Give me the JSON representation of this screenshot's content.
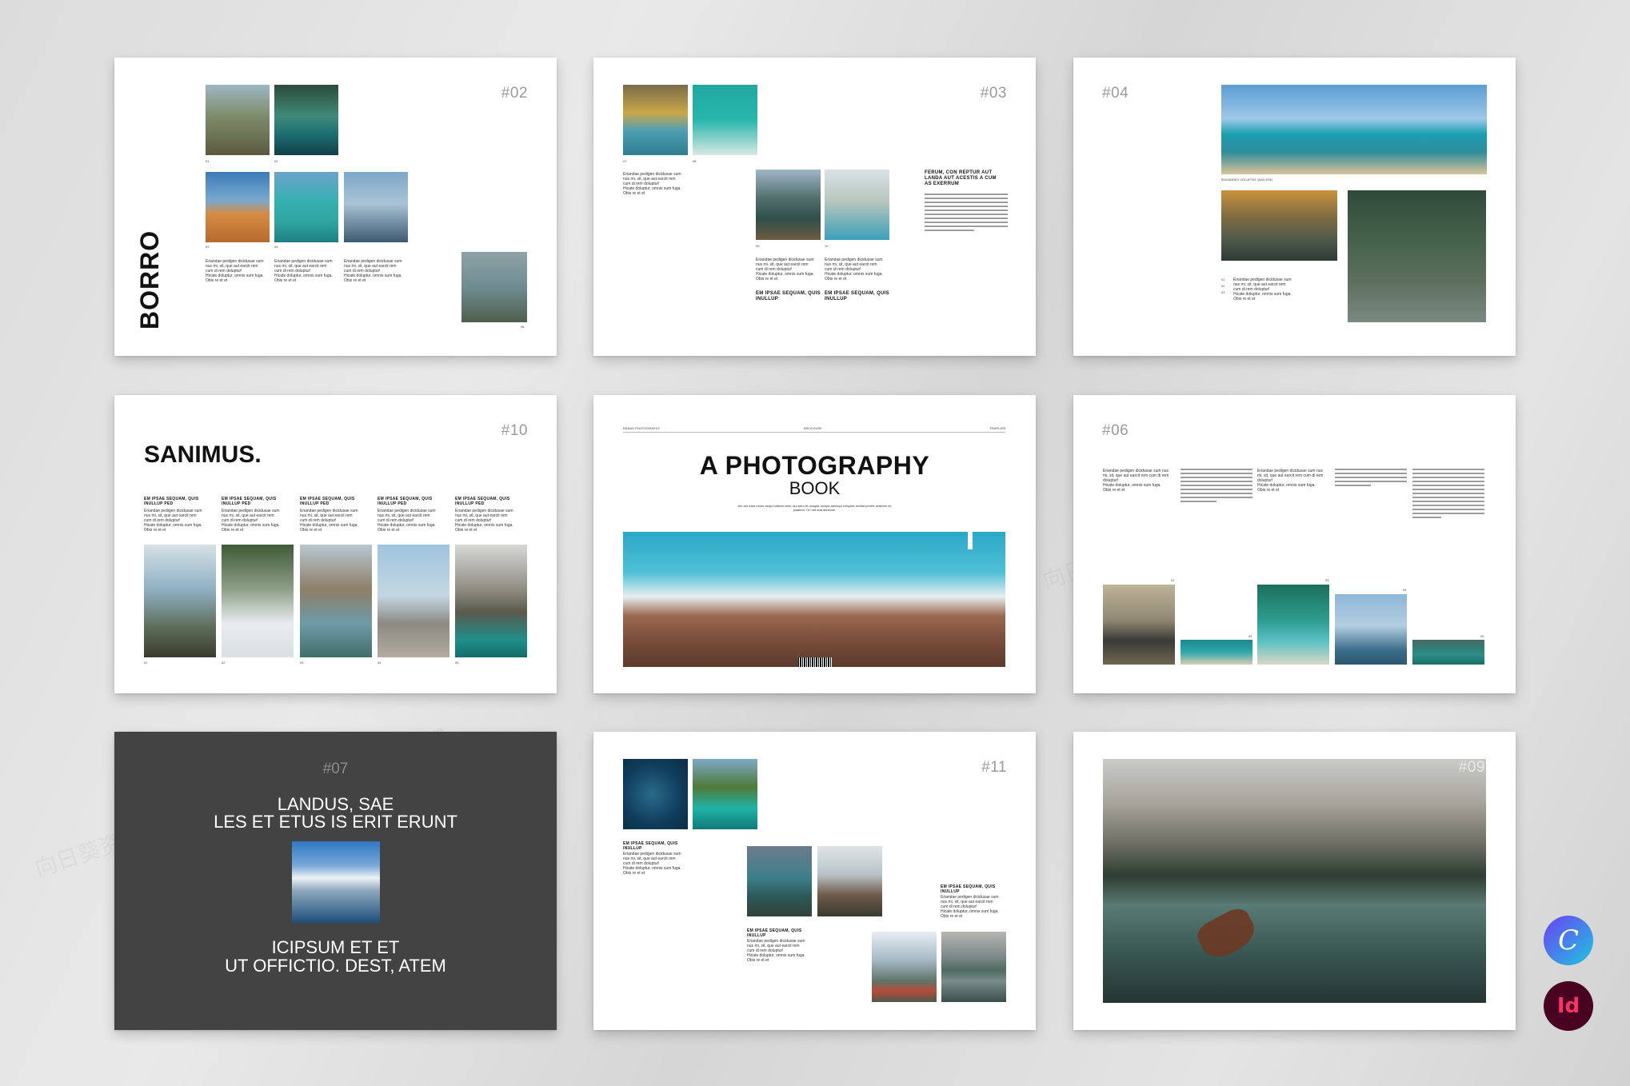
{
  "pages": {
    "p02": {
      "number": "#02",
      "title": "BORRO",
      "caption_01": "01",
      "caption_02": "02",
      "caption_03": "03",
      "caption_04": "04",
      "caption_05": "05",
      "caption_06": "06",
      "body": "Eriandae pedigen dicidusae sum\nnus mi, sit, que aut earcit rem\ncum di rem doluptur!\nHicate doluptur, omnis sum fuga.\nObis re et et"
    },
    "p03": {
      "number": "#03",
      "caption_07": "07",
      "caption_08": "08",
      "caption_09": "09",
      "caption_10": "10",
      "body": "Eriandae pedigen dicidusae sum\nnus mi, sit, que aut earcit rem\ncum di rem doluptur!\nHicate doluptur, omnis sum fuga.\nObis re et et",
      "heading": "EM IPSAE SEQUAM, QUIS\nINULLUP",
      "quote": "FERUM, CON REPTUR AUT\nLANDA AUT ACESTIS A CUM\nAS EXERRUM"
    },
    "p04": {
      "number": "#04",
      "caption": "BUDANDEX VOLUPTAT QIAS ESN",
      "item_1": "01",
      "item_2": "02",
      "item_3": "03",
      "body": "Eriandae pedigen dicidusae sum\nnus mi, sit, que aut earcit rem\ncum di rem doluptur!\nHicate doluptur, omnis sum fuga.\nObis re et et"
    },
    "p10": {
      "number": "#10",
      "title": "SANIMUS.",
      "column_heading": "EM IPSAE SEQUAM, QUIS\nINULLUP PED",
      "body": "Eriandae pedigen dicidusae sum\nnus mi, sit, que aut earcit rem\ncum di rem doluptur!\nHicate doluptur, omnis sum fuga.\nObis re et et",
      "captions": [
        "01",
        "02",
        "03",
        "04",
        "05"
      ]
    },
    "cover": {
      "top_left": "BRAND PHOTOGRAPHY",
      "top_center": "BROCHURE",
      "top_right": "TEMPLATE",
      "title": "A PHOTOGRAPHY",
      "subtitle": "BOOK",
      "intro": "Am am eara molor aequi blaboni iatet, aut pero te dolupta dolupti atemqui volupiae eiciliat prerfer ataleste ne\nplaatem. Ori unt ada atessum."
    },
    "p06": {
      "number": "#06",
      "body": "Eriandae pedigen dicidusae sum nus mi, sit, que aut earcit rem cum di rem doluptur!\nHicate doluptur, omnis sum fuga.\nObis re et et",
      "captions": [
        "01",
        "02",
        "03",
        "04",
        "05"
      ]
    },
    "p07": {
      "number": "#07",
      "line_1": "LANDUS, SAE",
      "line_2": "LES ET ETUS IS ERIT ERUNT",
      "line_3": "ICIPSUM ET ET",
      "line_4": "UT OFFICTIO. DEST, ATEM"
    },
    "p11": {
      "number": "#11",
      "heading": "EM IPSAE SEQUAM, QUIS\nINULLUP",
      "body": "Eriandae pedigen dicidusae sum\nnus mi, sit, que aut earcit rem\ncum di rem doluptur!\nHicate doluptur, omnis sum fuga.\nObis re et et"
    },
    "p09": {
      "number": "#09"
    }
  },
  "badges": {
    "canva": {
      "glyph": "C",
      "gradient": [
        "#6b3ff2",
        "#1fc6e0"
      ]
    },
    "indesign": {
      "glyph": "Id",
      "color": "#49021f",
      "text_color": "#ff3366"
    }
  },
  "watermark": {
    "text_1": "向日葵资源站",
    "text_2": "www.78sun.cn"
  },
  "colors": {
    "background": "#e0e0e0",
    "page": "#ffffff",
    "dark_page": "#434343"
  }
}
